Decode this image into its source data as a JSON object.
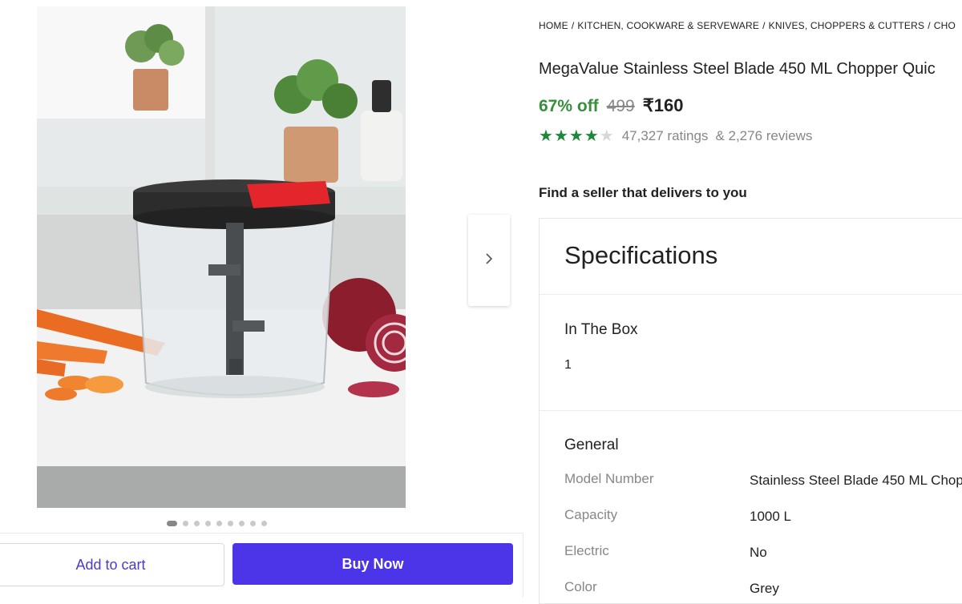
{
  "breadcrumb": [
    "HOME",
    "/",
    "KITCHEN, COOKWARE & SERVEWARE",
    "/",
    "KNIVES, CHOPPERS & CUTTERS",
    "/",
    "CHO"
  ],
  "product": {
    "title": "MegaValue Stainless Steel Blade 450 ML Chopper Quic",
    "discount": "67% off",
    "mrp": "499",
    "price": "₹160",
    "rating_stars": 4,
    "ratings": "47,327 ratings",
    "reviews": "& 2,276 reviews"
  },
  "seller": {
    "heading": "Find a seller that delivers to you"
  },
  "gallery": {
    "total_images": 9,
    "active_index": 0
  },
  "actions": {
    "add_to_cart": "Add to cart",
    "buy_now": "Buy Now"
  },
  "specifications": {
    "title": "Specifications",
    "in_the_box": {
      "title": "In The Box",
      "value": "1"
    },
    "general": {
      "title": "General",
      "rows": [
        {
          "key": "Model Number",
          "value": "Stainless Steel Blade 450 ML Chop"
        },
        {
          "key": "Capacity",
          "value": "1000 L"
        },
        {
          "key": "Electric",
          "value": "No"
        },
        {
          "key": "Color",
          "value": "Grey"
        }
      ]
    }
  },
  "colors": {
    "accent": "#4c35e8",
    "discount_green": "#388e3c",
    "star_green": "#1a8a3a"
  },
  "icons": {
    "next": "chevron-right-icon",
    "star": "star-icon"
  }
}
